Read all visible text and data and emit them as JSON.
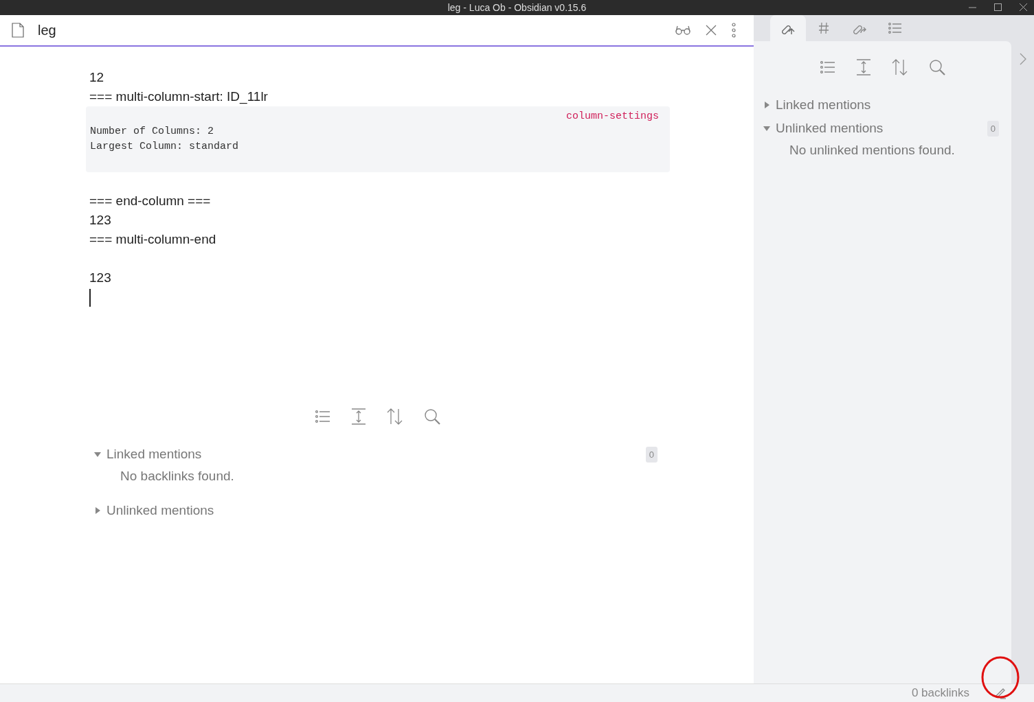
{
  "window": {
    "title": "leg - Luca Ob - Obsidian v0.15.6"
  },
  "note": {
    "title": "leg"
  },
  "editor": {
    "lines": [
      {
        "kind": "text",
        "text": "12"
      },
      {
        "kind": "text",
        "text": "=== multi-column-start: ID_11lr"
      },
      {
        "kind": "code",
        "label": "column-settings",
        "lines": [
          "Number of Columns: 2",
          "Largest Column: standard"
        ]
      },
      {
        "kind": "blank"
      },
      {
        "kind": "text",
        "text": "=== end-column ==="
      },
      {
        "kind": "text",
        "text": "123"
      },
      {
        "kind": "text",
        "text": "=== multi-column-end"
      },
      {
        "kind": "blank"
      },
      {
        "kind": "text",
        "text": "123"
      },
      {
        "kind": "cursor"
      }
    ]
  },
  "backlinks": {
    "sections": [
      {
        "title": "Linked mentions",
        "expanded": true,
        "count": "0",
        "message": "No backlinks found."
      },
      {
        "title": "Unlinked mentions",
        "expanded": false
      }
    ]
  },
  "sidebar": {
    "tabs": [
      {
        "kind": "backlinks",
        "selected": true
      },
      {
        "kind": "tags",
        "selected": false
      },
      {
        "kind": "outgoing",
        "selected": false
      },
      {
        "kind": "outline",
        "selected": false
      }
    ],
    "sections": [
      {
        "title": "Linked mentions",
        "expanded": false
      },
      {
        "title": "Unlinked mentions",
        "expanded": true,
        "count": "0",
        "message": "No unlinked mentions found."
      }
    ]
  },
  "status_bar": {
    "text": "0 backlinks"
  }
}
